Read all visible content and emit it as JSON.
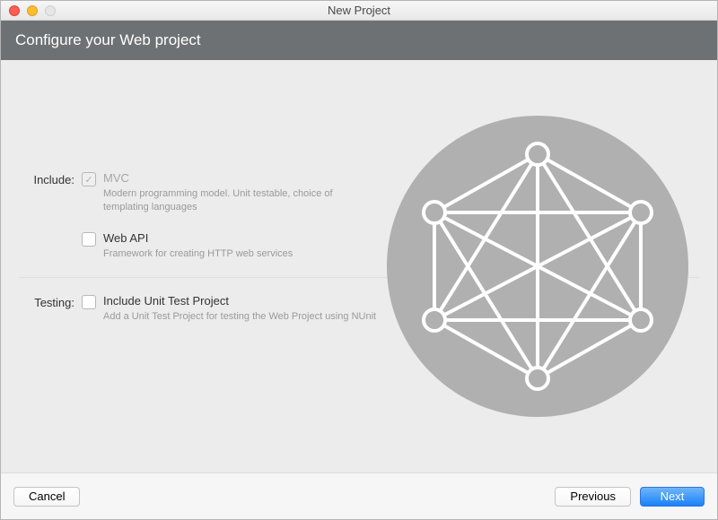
{
  "window": {
    "title": "New Project"
  },
  "banner": {
    "title": "Configure your Web project"
  },
  "form": {
    "includeLabel": "Include:",
    "testingLabel": "Testing:",
    "mvc": {
      "label": "MVC",
      "desc": "Modern programming model. Unit testable, choice of templating languages"
    },
    "webapi": {
      "label": "Web API",
      "desc": "Framework for creating HTTP web services"
    },
    "unittest": {
      "label": "Include Unit Test Project",
      "desc": "Add a Unit Test Project for testing the Web Project using NUnit"
    }
  },
  "footer": {
    "cancel": "Cancel",
    "previous": "Previous",
    "next": "Next"
  }
}
